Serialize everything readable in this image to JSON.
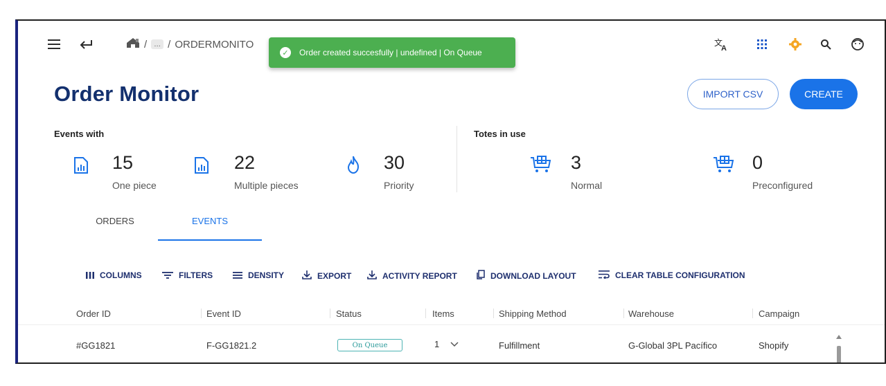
{
  "topbar": {
    "menu_icon": "hamburger-menu-icon",
    "back_icon": "back-arrow-icon",
    "home_icon": "home-icon",
    "breadcrumb_sep1": "/",
    "breadcrumb_more": "…",
    "breadcrumb_sep2": "/",
    "breadcrumb_current": "ORDERMONITO",
    "icons": [
      "translate-icon",
      "apps-grid-icon",
      "settings-gear-icon",
      "search-icon",
      "user-face-icon"
    ]
  },
  "toast": {
    "message": "Order created succesfully | undefined | On Queue",
    "color": "#4caf50"
  },
  "page": {
    "title": "Order Monitor",
    "import_label": "IMPORT CSV",
    "create_label": "CREATE"
  },
  "events_section": {
    "label": "Events with",
    "stats": [
      {
        "value": "15",
        "caption": "One piece",
        "icon": "document-chart-icon"
      },
      {
        "value": "22",
        "caption": "Multiple pieces",
        "icon": "document-chart-icon"
      },
      {
        "value": "30",
        "caption": "Priority",
        "icon": "flame-icon"
      }
    ]
  },
  "totes_section": {
    "label": "Totes in use",
    "stats": [
      {
        "value": "3",
        "caption": "Normal",
        "icon": "shopping-cart-icon"
      },
      {
        "value": "0",
        "caption": "Preconfigured",
        "icon": "shopping-cart-icon"
      }
    ]
  },
  "tabs": [
    {
      "label": "ORDERS",
      "active": false
    },
    {
      "label": "EVENTS",
      "active": true
    }
  ],
  "toolbar": [
    {
      "label": "COLUMNS",
      "icon": "columns-icon"
    },
    {
      "label": "FILTERS",
      "icon": "filter-icon"
    },
    {
      "label": "DENSITY",
      "icon": "density-icon"
    },
    {
      "label": "EXPORT",
      "icon": "download-icon"
    },
    {
      "label": "ACTIVITY REPORT",
      "icon": "download-icon"
    },
    {
      "label": "DOWNLOAD LAYOUT",
      "icon": "copy-icon"
    },
    {
      "label": "CLEAR TABLE CONFIGURATION",
      "icon": "wrap-text-icon"
    }
  ],
  "table": {
    "columns": [
      "Order ID",
      "Event ID",
      "Status",
      "Items",
      "Shipping Method",
      "Warehouse",
      "Campaign"
    ],
    "rows": [
      {
        "order_id": "#GG1821",
        "event_id": "F-GG1821.2",
        "status": "On Queue",
        "items": "1",
        "shipping_method": "Fulfillment",
        "warehouse": "G-Global 3PL Pacífico",
        "campaign": "Shopify"
      }
    ]
  },
  "colors": {
    "title": "#13306e",
    "accent": "#1a73e8",
    "toolbar_text": "#1e2f6e",
    "status_badge": "#4cb3b3",
    "settings_icon": "#f5a623"
  }
}
